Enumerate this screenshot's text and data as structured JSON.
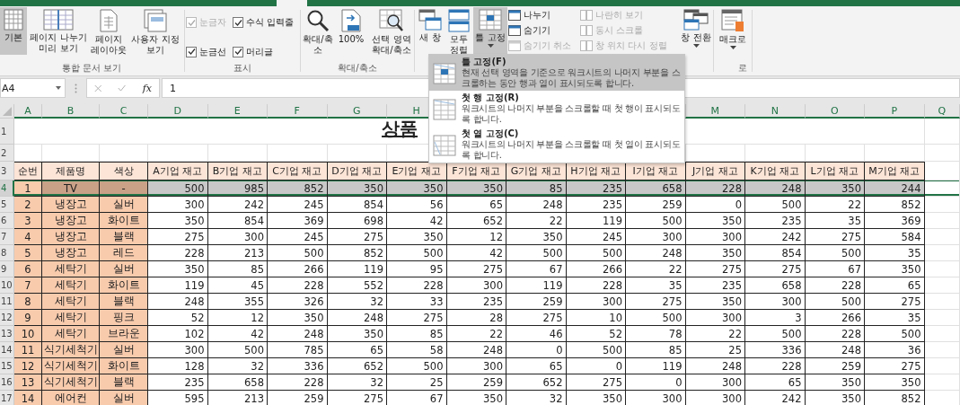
{
  "ribbon": {
    "workbook_views": {
      "label": "통합 문서 보기",
      "buttons": [
        {
          "label": "기본",
          "selected": true
        },
        {
          "label": "페이지 나누기 미리 보기",
          "selected": false
        },
        {
          "label": "페이지 레이아웃",
          "selected": false
        },
        {
          "label": "사용자 지정 보기",
          "selected": false
        }
      ]
    },
    "show": {
      "label": "표시",
      "checks": [
        {
          "label": "눈금자",
          "checked": true,
          "disabled": true
        },
        {
          "label": "수식 입력줄",
          "checked": true,
          "disabled": false
        },
        {
          "label": "눈금선",
          "checked": true,
          "disabled": false
        },
        {
          "label": "머리글",
          "checked": true,
          "disabled": false
        }
      ]
    },
    "zoom": {
      "label": "확대/축소",
      "buttons": [
        {
          "label": "확대/축소"
        },
        {
          "label": "100%"
        },
        {
          "label": "선택 영역 확대/축소"
        }
      ]
    },
    "window": {
      "buttons": [
        {
          "label": "새 창",
          "selected": false
        },
        {
          "label": "모두 정렬",
          "selected": false
        },
        {
          "label": "틀 고정",
          "selected": true
        }
      ],
      "small": [
        {
          "label": "나누기",
          "disabled": false
        },
        {
          "label": "숨기기",
          "disabled": false
        },
        {
          "label": "숨기기 취소",
          "disabled": true
        },
        {
          "label": "나란히 보기",
          "disabled": true
        },
        {
          "label": "동시 스크롤",
          "disabled": true
        },
        {
          "label": "창 위치 다시 정렬",
          "disabled": true
        }
      ],
      "switch": "창 전환"
    },
    "macro": {
      "label": "로",
      "button": "매크로"
    }
  },
  "name_box": "A4",
  "function_label": "fx",
  "formula": "1",
  "column_headers_left": [
    "A",
    "B",
    "C",
    "D",
    "E",
    "F",
    "G",
    "H"
  ],
  "column_headers_right": [
    "M",
    "N",
    "O",
    "P",
    "Q"
  ],
  "sheet": {
    "title": "상품",
    "row_numbers": [
      "1",
      "2",
      "3",
      "4",
      "5",
      "6",
      "7",
      "8",
      "9",
      "10",
      "11",
      "12",
      "13",
      "14",
      "15",
      "16",
      "17"
    ],
    "header": [
      "순번",
      "제품명",
      "색상",
      "A기업 재고",
      "B기업 재고",
      "C기업 재고",
      "D기업 재고",
      "E기업 재고",
      "F기업 재고",
      "G기업 재고",
      "H기업 재고",
      "I기업 재고",
      "J기업 재고",
      "K기업 재고",
      "L기업 재고",
      "M기업 재고"
    ],
    "rows": [
      {
        "selected": true,
        "cells": [
          "1",
          "TV",
          "-",
          "500",
          "985",
          "852",
          "350",
          "350",
          "350",
          "85",
          "235",
          "658",
          "228",
          "248",
          "350",
          "244"
        ]
      },
      {
        "selected": false,
        "cells": [
          "2",
          "냉장고",
          "실버",
          "300",
          "242",
          "245",
          "854",
          "56",
          "65",
          "248",
          "235",
          "259",
          "0",
          "500",
          "22",
          "852"
        ]
      },
      {
        "selected": false,
        "cells": [
          "3",
          "냉장고",
          "화이트",
          "350",
          "854",
          "369",
          "698",
          "42",
          "652",
          "22",
          "119",
          "500",
          "350",
          "235",
          "35",
          "369"
        ]
      },
      {
        "selected": false,
        "cells": [
          "4",
          "냉장고",
          "블랙",
          "275",
          "300",
          "245",
          "275",
          "350",
          "12",
          "350",
          "245",
          "300",
          "300",
          "242",
          "275",
          "584"
        ]
      },
      {
        "selected": false,
        "cells": [
          "5",
          "냉장고",
          "레드",
          "228",
          "213",
          "500",
          "852",
          "500",
          "42",
          "500",
          "500",
          "248",
          "350",
          "854",
          "500",
          "35"
        ]
      },
      {
        "selected": false,
        "cells": [
          "6",
          "세탁기",
          "실버",
          "350",
          "85",
          "266",
          "119",
          "95",
          "275",
          "67",
          "266",
          "22",
          "275",
          "275",
          "67",
          "350"
        ]
      },
      {
        "selected": false,
        "cells": [
          "7",
          "세탁기",
          "화이트",
          "119",
          "45",
          "228",
          "552",
          "228",
          "300",
          "119",
          "228",
          "35",
          "235",
          "658",
          "228",
          "65"
        ]
      },
      {
        "selected": false,
        "cells": [
          "8",
          "세탁기",
          "블랙",
          "248",
          "355",
          "326",
          "32",
          "33",
          "235",
          "259",
          "300",
          "275",
          "350",
          "300",
          "500",
          "275"
        ]
      },
      {
        "selected": false,
        "cells": [
          "9",
          "세탁기",
          "핑크",
          "52",
          "12",
          "350",
          "248",
          "275",
          "28",
          "275",
          "10",
          "500",
          "300",
          "3",
          "266",
          "35"
        ]
      },
      {
        "selected": false,
        "cells": [
          "10",
          "세탁기",
          "브라운",
          "102",
          "42",
          "248",
          "350",
          "85",
          "22",
          "46",
          "52",
          "78",
          "22",
          "500",
          "228",
          "500"
        ]
      },
      {
        "selected": false,
        "cells": [
          "11",
          "식기세척기",
          "실버",
          "300",
          "500",
          "785",
          "65",
          "58",
          "248",
          "0",
          "500",
          "85",
          "25",
          "336",
          "248",
          "36"
        ]
      },
      {
        "selected": false,
        "cells": [
          "12",
          "식기세척기",
          "화이트",
          "128",
          "32",
          "336",
          "652",
          "500",
          "300",
          "65",
          "0",
          "119",
          "248",
          "228",
          "259",
          "275"
        ]
      },
      {
        "selected": false,
        "cells": [
          "13",
          "식기세척기",
          "블랙",
          "235",
          "658",
          "228",
          "32",
          "25",
          "259",
          "652",
          "275",
          "0",
          "300",
          "65",
          "350",
          "350"
        ]
      },
      {
        "selected": false,
        "cells": [
          "14",
          "에어컨",
          "실버",
          "595",
          "213",
          "259",
          "275",
          "67",
          "350",
          "32",
          "350",
          "300",
          "300",
          "242",
          "350",
          "852"
        ]
      }
    ]
  },
  "freeze_menu": [
    {
      "title": "틀 고정(F)",
      "description": "현재 선택 영역을 기준으로 워크시트의 나머지 부분을 스크롤하는 동안 행과 열이 표시되도록 합니다.",
      "selected": true
    },
    {
      "title": "첫 행 고정(R)",
      "description": "워크시트의 나머지 부분을 스크롤할 때 첫 행이 표시되도록 합니다.",
      "selected": false
    },
    {
      "title": "첫 열 고정(C)",
      "description": "워크시트의 나머지 부분을 스크롤할 때 첫 열이 표시되도록 합니다.",
      "selected": false
    }
  ]
}
